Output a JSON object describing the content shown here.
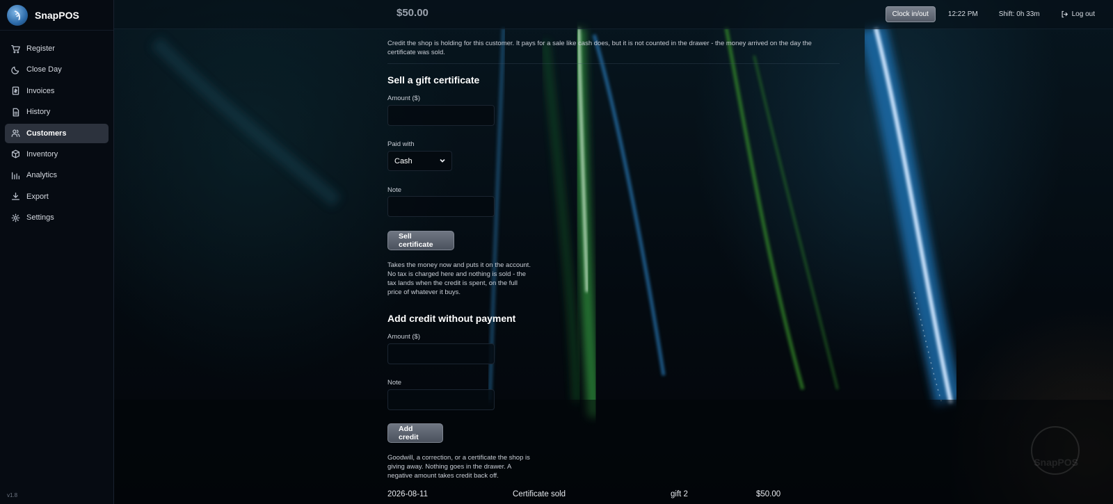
{
  "app": {
    "name": "SnapPOS",
    "version": "v1.8"
  },
  "sidebar": {
    "items": [
      {
        "label": "Register",
        "icon": "cart-icon"
      },
      {
        "label": "Close Day",
        "icon": "moon-icon"
      },
      {
        "label": "Invoices",
        "icon": "invoice-icon"
      },
      {
        "label": "History",
        "icon": "document-icon"
      },
      {
        "label": "Customers",
        "icon": "users-icon",
        "active": true
      },
      {
        "label": "Inventory",
        "icon": "box-icon"
      },
      {
        "label": "Analytics",
        "icon": "bar-chart-icon"
      },
      {
        "label": "Export",
        "icon": "download-icon"
      },
      {
        "label": "Settings",
        "icon": "gear-icon"
      }
    ]
  },
  "topbar": {
    "clock_button": "Clock in/out",
    "time": "12:22 PM",
    "shift": "Shift: 0h 33m",
    "logout": "Log out",
    "balance_peek": "$50.00"
  },
  "credit_section": {
    "description": "Credit the shop is holding for this customer. It pays for a sale like cash does, but it is not counted in the drawer - the money arrived on the day the certificate was sold."
  },
  "gift_certificate": {
    "heading": "Sell a gift certificate",
    "amount_label": "Amount ($)",
    "amount_value": "",
    "paid_with_label": "Paid with",
    "paid_with_value": "Cash",
    "note_label": "Note",
    "note_value": "",
    "button": "Sell certificate",
    "help": "Takes the money now and puts it on the account. No tax is charged here and nothing is sold - the tax lands when the credit is spent, on the full price of whatever it buys."
  },
  "add_credit": {
    "heading": "Add credit without payment",
    "amount_label": "Amount ($)",
    "amount_value": "",
    "note_label": "Note",
    "note_value": "",
    "button": "Add credit",
    "help": "Goodwill, a correction, or a certificate the shop is giving away. Nothing goes in the drawer. A negative amount takes credit back off."
  },
  "ledger": [
    {
      "date": "2026-08-11",
      "type": "Certificate sold",
      "note": "gift 2",
      "amount": "$50.00"
    }
  ],
  "colors": {
    "accent": "#2c6aa8",
    "active_nav": "#2c323d",
    "button": "#5e6571"
  }
}
